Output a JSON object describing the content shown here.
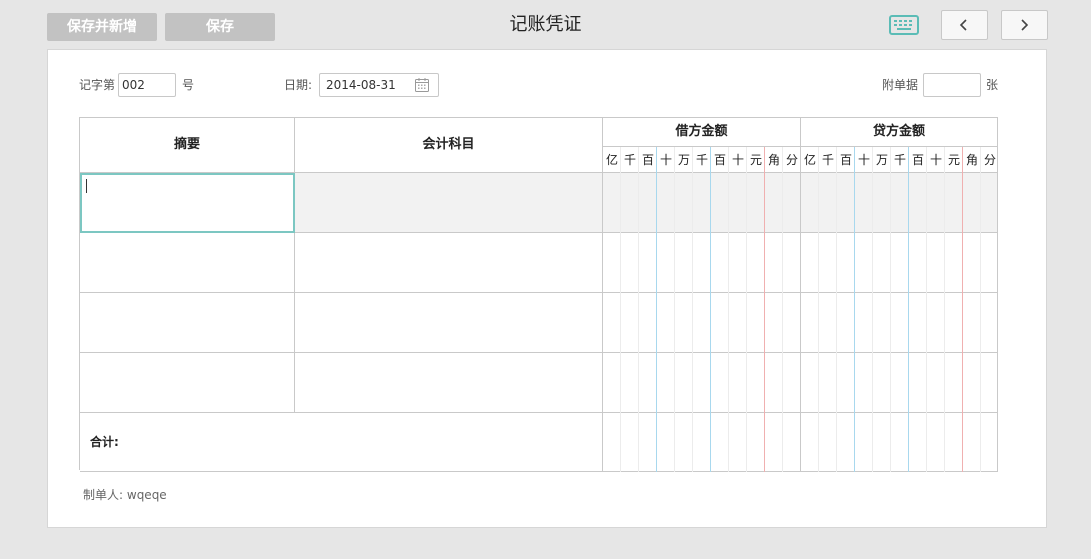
{
  "toolbar": {
    "save_and_new_label": "保存并新增",
    "save_label": "保存",
    "title": "记账凭证"
  },
  "icons": {
    "keyboard": "keyboard-icon",
    "prev": "chevron-left-icon",
    "next": "chevron-right-icon",
    "calendar": "calendar-icon"
  },
  "colors": {
    "accent": "#5bbcb6",
    "debit_separator_blue": "#a8d8ee",
    "yuan_separator_red": "#f0b0b0"
  },
  "header": {
    "voucher_prefix": "记字第",
    "voucher_number": "002",
    "voucher_suffix": "号",
    "date_label": "日期:",
    "date_value": "2014-08-31",
    "attachment_label": "附单据",
    "attachment_value": "",
    "attachment_suffix": "张"
  },
  "table": {
    "col_summary": "摘要",
    "col_account": "会计科目",
    "col_debit": "借方金额",
    "col_credit": "贷方金额",
    "digit_units": [
      "亿",
      "千",
      "百",
      "十",
      "万",
      "千",
      "百",
      "十",
      "元",
      "角",
      "分"
    ],
    "rows": [
      {
        "summary": "",
        "account": ""
      },
      {
        "summary": "",
        "account": ""
      },
      {
        "summary": "",
        "account": ""
      },
      {
        "summary": "",
        "account": ""
      }
    ],
    "total_label": "合计:"
  },
  "footer": {
    "creator_label": "制单人:",
    "creator_name": "wqeqe"
  }
}
